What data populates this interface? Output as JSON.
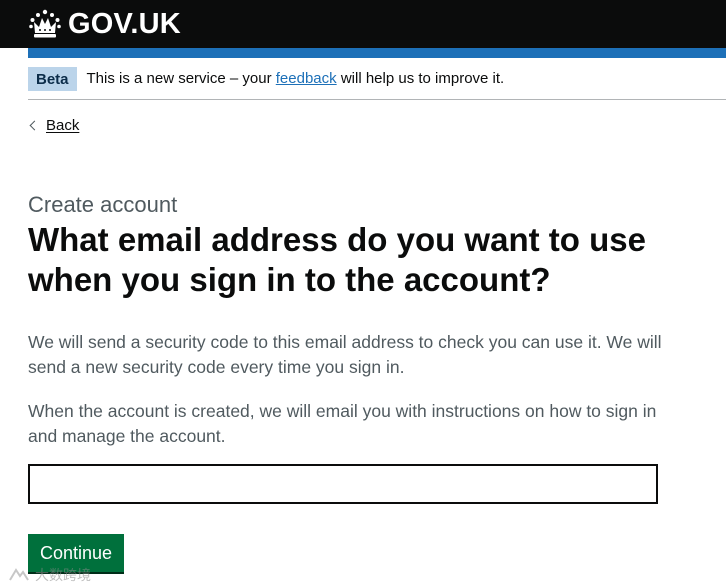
{
  "header": {
    "logo_text": "GOV.UK",
    "logo_icon": "crown-icon",
    "background_color": "#0b0c0c",
    "accent_bar_color": "#1d70b8"
  },
  "phase_banner": {
    "tag": "Beta",
    "text_before": "This is a new service – your ",
    "link_text": "feedback",
    "text_after": " will help us to improve it."
  },
  "back_link": {
    "label": "Back",
    "icon": "chevron-left-icon"
  },
  "main": {
    "caption": "Create account",
    "heading": "What email address do you want to use when you sign in to the account?",
    "paragraphs": [
      "We will send a security code to this email address to check you can use it. We will send a new security code every time you sign in.",
      "When the account is created, we will email you with instructions on how to sign in and manage the account."
    ],
    "email_input": {
      "value": "",
      "placeholder": ""
    },
    "continue_label": "Continue",
    "button_color": "#00703c"
  },
  "watermark": {
    "text": "大数跨境",
    "icon": "watermark-logo-icon"
  }
}
